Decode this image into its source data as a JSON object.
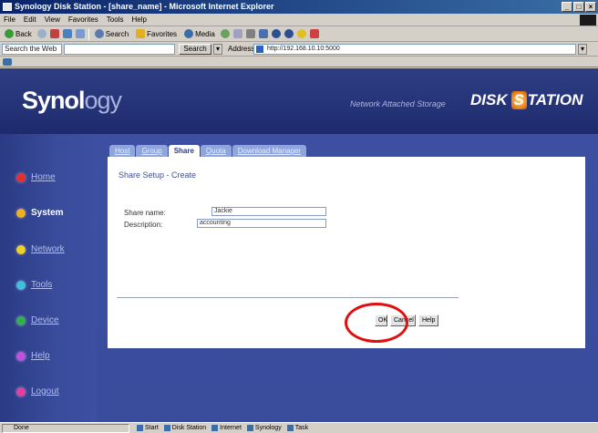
{
  "window": {
    "title": "Synology Disk Station - [share_name] - Microsoft Internet Explorer",
    "controls": [
      "_",
      "□",
      "×"
    ]
  },
  "menubar": {
    "items": [
      "File",
      "Edit",
      "View",
      "Favorites",
      "Tools",
      "Help"
    ]
  },
  "toolbar": {
    "back_label": "Back",
    "search_label": "Search",
    "favorites_label": "Favorites",
    "media_label": "Media"
  },
  "addressbar": {
    "search_label": "Search the Web",
    "search_button": "Search",
    "address_label": "Address",
    "url": "http://192.168.10.10:5000"
  },
  "header": {
    "logo_bold": "Synol",
    "logo_light": "ogy",
    "tagline": "Network Attached Storage",
    "ds_prefix": "DISK",
    "ds_badge": "S",
    "ds_suffix": "TATION"
  },
  "sidebar": {
    "items": [
      {
        "label": "Home",
        "color": "#e23030"
      },
      {
        "label": "System",
        "color": "#f0b020"
      },
      {
        "label": "Network",
        "color": "#f0d020"
      },
      {
        "label": "Tools",
        "color": "#40c0e0"
      },
      {
        "label": "Device",
        "color": "#30b050"
      },
      {
        "label": "Help",
        "color": "#c050e0"
      },
      {
        "label": "Logout",
        "color": "#e040a0"
      }
    ],
    "active": "System"
  },
  "tabs": [
    "Host",
    "Group",
    "Share",
    "Quota",
    "Download Manager"
  ],
  "active_tab": "Share",
  "panel": {
    "title": "Share Setup - Create",
    "share_name_label": "Share name:",
    "share_name_value": "Jackie",
    "description_label": "Description:",
    "description_value": "accounting"
  },
  "buttons": {
    "ok": "OK",
    "cancel": "Cancel",
    "help": "Help"
  },
  "statusbar": {
    "left": "Done",
    "tasks": [
      "Start",
      "Disk Station",
      "Internet",
      "Synology",
      "Task"
    ]
  }
}
